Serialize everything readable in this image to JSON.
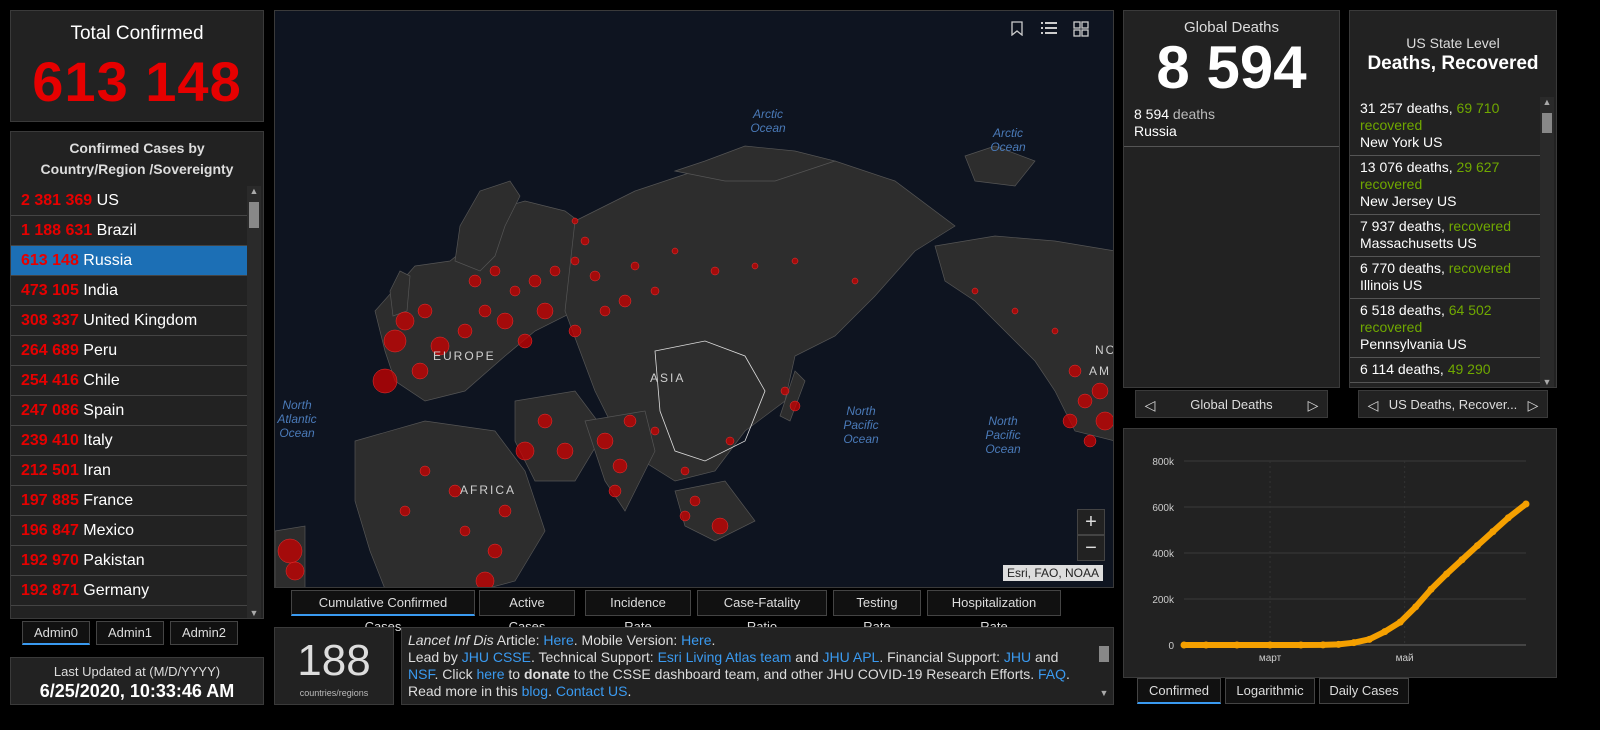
{
  "total": {
    "title": "Total Confirmed",
    "value": "613 148"
  },
  "country_list": {
    "header": "Confirmed Cases by Country/Region /Sovereignty",
    "rows": [
      {
        "count": "2 381 369",
        "name": "US"
      },
      {
        "count": "1 188 631",
        "name": "Brazil"
      },
      {
        "count": "613 148",
        "name": "Russia",
        "selected": true
      },
      {
        "count": "473 105",
        "name": "India"
      },
      {
        "count": "308 337",
        "name": "United Kingdom"
      },
      {
        "count": "264 689",
        "name": "Peru"
      },
      {
        "count": "254 416",
        "name": "Chile"
      },
      {
        "count": "247 086",
        "name": "Spain"
      },
      {
        "count": "239 410",
        "name": "Italy"
      },
      {
        "count": "212 501",
        "name": "Iran"
      },
      {
        "count": "197 885",
        "name": "France"
      },
      {
        "count": "196 847",
        "name": "Mexico"
      },
      {
        "count": "192 970",
        "name": "Pakistan"
      },
      {
        "count": "192 871",
        "name": "Germany"
      }
    ]
  },
  "admin_tabs": [
    "Admin0",
    "Admin1",
    "Admin2"
  ],
  "updated": {
    "label": "Last Updated at (M/D/YYYY)",
    "value": "6/25/2020, 10:33:46 AM"
  },
  "map": {
    "attribution": "Esri, FAO, NOAA",
    "zoom_in": "+",
    "zoom_out": "−",
    "labels": {
      "arctic1": "Arctic Ocean",
      "arctic2": "Arctic Ocean",
      "natl": "North Atlantic Ocean",
      "npac1": "North Pacific Ocean",
      "npac2": "North Pacific Ocean",
      "europe": "EUROPE",
      "asia": "ASIA",
      "africa": "AFRICA",
      "no": "NO",
      "am": "AM"
    },
    "tabs": [
      "Cumulative Confirmed Cases",
      "Active Cases",
      "Incidence Rate",
      "Case-Fatality Ratio",
      "Testing Rate",
      "Hospitalization Rate"
    ]
  },
  "count": {
    "value": "188",
    "label": "countries/regions"
  },
  "info": {
    "p1": "Lancet Inf Dis",
    "p2": " Article: ",
    "p3": "Here",
    "p4": ". Mobile Version: ",
    "p5": "Here",
    "p6": ".",
    "p7": "Lead by ",
    "p8": "JHU CSSE",
    "p9": ". Technical Support: ",
    "p10": "Esri Living Atlas team",
    "p11": " and ",
    "p12": "JHU APL",
    "p13": ". Financial Support: ",
    "p14": "JHU",
    "p15": " and ",
    "p16": "NSF",
    "p17": ". Click ",
    "p18": "here",
    "p19": " to ",
    "p20": "donate",
    "p21": " to the CSSE dashboard team, and other JHU COVID-19 Research Efforts. ",
    "p22": "FAQ",
    "p23": ". Read more in this ",
    "p24": "blog",
    "p25": ". ",
    "p26": "Contact US",
    "p27": "."
  },
  "deaths": {
    "title": "Global Deaths",
    "value": "8 594",
    "row_count": "8 594",
    "row_unit": " deaths",
    "row_name": "Russia",
    "nav_label": "Global Deaths"
  },
  "us": {
    "title1": "US State Level",
    "title2": "Deaths, Recovered",
    "rows": [
      {
        "deaths": "31 257 deaths, ",
        "recovered_n": "69 710",
        "recovered": "recovered",
        "name": "New York US"
      },
      {
        "deaths": "13 076 deaths, ",
        "recovered_n": "29 627",
        "recovered": "recovered",
        "name": "New Jersey US"
      },
      {
        "deaths": "7 937 deaths, ",
        "recovered_n": "",
        "recovered": "recovered",
        "name": "Massachusetts US"
      },
      {
        "deaths": "6 770 deaths, ",
        "recovered_n": "",
        "recovered": "recovered",
        "name": "Illinois US"
      },
      {
        "deaths": "6 518 deaths, ",
        "recovered_n": "64 502",
        "recovered": "recovered",
        "name": "Pennsylvania US"
      },
      {
        "deaths": "6 114 deaths, ",
        "recovered_n": "49 290",
        "recovered": "",
        "name": ""
      }
    ],
    "nav_label": "US Deaths, Recover..."
  },
  "chart_tabs": [
    "Confirmed",
    "Logarithmic",
    "Daily Cases"
  ],
  "colors": {
    "accent": "#3a9af0",
    "confirmed": "#e60000",
    "recovered": "#70a800",
    "line": "#f5a000"
  },
  "chart_data": {
    "type": "line",
    "title": "",
    "xlabel": "",
    "ylabel": "",
    "x_ticks": [
      "март",
      "май"
    ],
    "y_ticks": [
      "0",
      "200k",
      "400k",
      "600k",
      "800k"
    ],
    "ylim": [
      0,
      800000
    ],
    "grid": true,
    "series": [
      {
        "x": [
          "2020-01-22",
          "2020-02-01",
          "2020-02-15",
          "2020-03-01",
          "2020-03-15",
          "2020-03-25",
          "2020-04-01",
          "2020-04-08",
          "2020-04-15",
          "2020-04-22",
          "2020-04-29",
          "2020-05-06",
          "2020-05-13",
          "2020-05-20",
          "2020-05-27",
          "2020-06-03",
          "2020-06-10",
          "2020-06-17",
          "2020-06-25"
        ],
        "y": [
          0,
          2,
          2,
          3,
          63,
          658,
          2777,
          10131,
          24490,
          57999,
          99399,
          165929,
          242271,
          308705,
          370680,
          432277,
          493023,
          553301,
          613148
        ]
      }
    ]
  }
}
